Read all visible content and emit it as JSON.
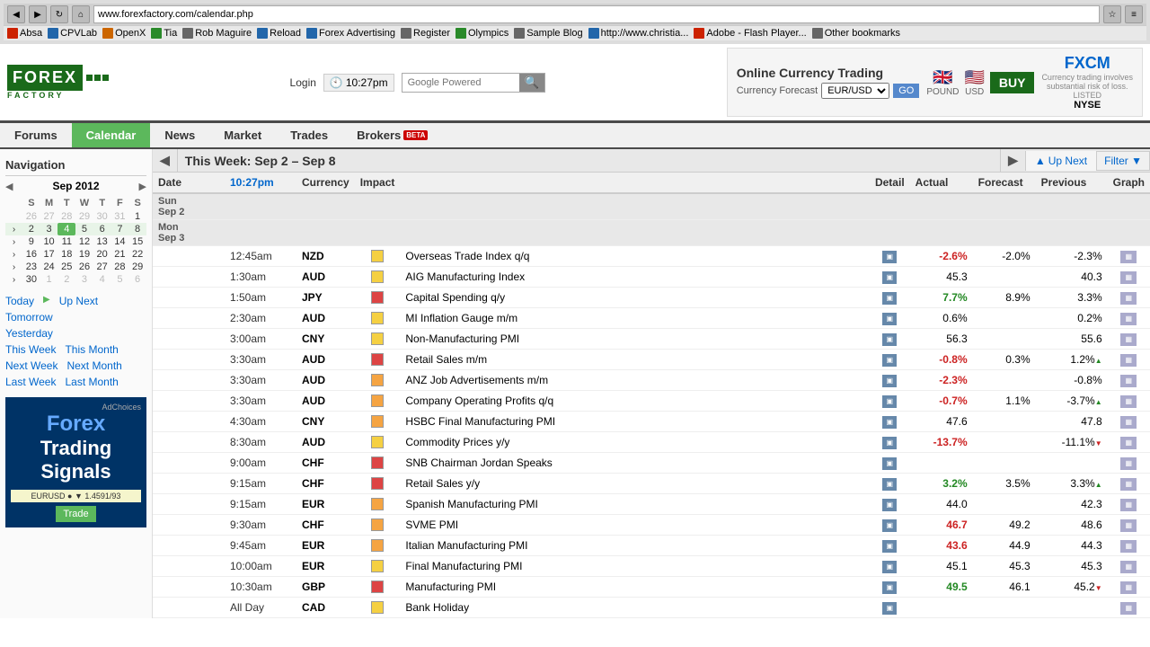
{
  "browser": {
    "url": "www.forexfactory.com/calendar.php",
    "bookmarks": [
      {
        "label": "Absa",
        "icon": "red"
      },
      {
        "label": "CPVLab",
        "icon": "blue"
      },
      {
        "label": "OpenX",
        "icon": "orange"
      },
      {
        "label": "Tia",
        "icon": "green"
      },
      {
        "label": "Rob Maguire",
        "icon": "gray"
      },
      {
        "label": "Reload",
        "icon": "blue"
      },
      {
        "label": "Forex Advertising",
        "icon": "blue"
      },
      {
        "label": "Register",
        "icon": "gray"
      },
      {
        "label": "Olympics",
        "icon": "green"
      },
      {
        "label": "Sample Blog",
        "icon": "gray"
      },
      {
        "label": "http://www.christia...",
        "icon": "blue"
      },
      {
        "label": "Adobe - Flash Player...",
        "icon": "red"
      },
      {
        "label": "Other bookmarks",
        "icon": "gray"
      }
    ]
  },
  "header": {
    "logo_top": "FOREX",
    "logo_bottom": "FACTORY",
    "login_label": "Login",
    "time_label": "10:27pm",
    "search_placeholder": "Google Powered",
    "ad_title": "Online Currency Trading",
    "ad_currency_label": "Currency Forecast",
    "ad_currency_value": "EUR/USD",
    "ad_go_label": "GO",
    "ad_logo": "FXCM",
    "ad_listed": "NYSE"
  },
  "nav": {
    "items": [
      {
        "label": "Forums",
        "active": false
      },
      {
        "label": "Calendar",
        "active": true
      },
      {
        "label": "News",
        "active": false
      },
      {
        "label": "Market",
        "active": false
      },
      {
        "label": "Trades",
        "active": false
      },
      {
        "label": "Brokers",
        "active": false,
        "beta": true
      }
    ]
  },
  "sidebar": {
    "title": "Navigation",
    "calendar": {
      "month_year": "Sep 2012",
      "headers": [
        "S",
        "M",
        "T",
        "W",
        "T",
        "F",
        "S"
      ],
      "weeks": [
        {
          "num": "",
          "days": [
            {
              "d": "26",
              "other": true
            },
            {
              "d": "27",
              "other": true
            },
            {
              "d": "28",
              "other": true
            },
            {
              "d": "29",
              "other": true
            },
            {
              "d": "30",
              "other": true
            },
            {
              "d": "31",
              "other": true
            },
            {
              "d": "1",
              "weekend": false
            }
          ]
        },
        {
          "num": "",
          "days": [
            {
              "d": "2",
              "cur": true,
              "weekend": true
            },
            {
              "d": "3",
              "cur": true
            },
            {
              "d": "4",
              "cur": true
            },
            {
              "d": "5",
              "cur": true
            },
            {
              "d": "6",
              "cur": true
            },
            {
              "d": "7",
              "cur": true
            },
            {
              "d": "8",
              "cur": true,
              "weekend": true
            }
          ]
        },
        {
          "num": "",
          "days": [
            {
              "d": "9",
              "weekend": true
            },
            {
              "d": "10"
            },
            {
              "d": "11"
            },
            {
              "d": "12"
            },
            {
              "d": "13"
            },
            {
              "d": "14"
            },
            {
              "d": "15",
              "weekend": true
            }
          ]
        },
        {
          "num": "",
          "days": [
            {
              "d": "16",
              "weekend": true
            },
            {
              "d": "17"
            },
            {
              "d": "18"
            },
            {
              "d": "19"
            },
            {
              "d": "20"
            },
            {
              "d": "21"
            },
            {
              "d": "22",
              "weekend": true
            }
          ]
        },
        {
          "num": "",
          "days": [
            {
              "d": "23",
              "weekend": true
            },
            {
              "d": "24"
            },
            {
              "d": "25"
            },
            {
              "d": "26"
            },
            {
              "d": "27"
            },
            {
              "d": "28"
            },
            {
              "d": "29",
              "weekend": true
            }
          ]
        },
        {
          "num": "",
          "days": [
            {
              "d": "30",
              "weekend": true
            },
            {
              "d": "1",
              "other": true
            },
            {
              "d": "2",
              "other": true
            },
            {
              "d": "3",
              "other": true
            },
            {
              "d": "4",
              "other": true
            },
            {
              "d": "5",
              "other": true
            },
            {
              "d": "6",
              "other": true,
              "weekend": true
            }
          ]
        }
      ]
    },
    "quick_links": [
      {
        "label": "Today",
        "href": "#"
      },
      {
        "label": "Up Next",
        "href": "#"
      },
      {
        "label": "Tomorrow",
        "href": "#"
      },
      {
        "label": "Yesterday",
        "href": "#"
      },
      {
        "label": "This Week",
        "href": "#"
      },
      {
        "label": "This Month",
        "href": "#"
      },
      {
        "label": "Next Week",
        "href": "#"
      },
      {
        "label": "Next Month",
        "href": "#"
      },
      {
        "label": "Last Week",
        "href": "#"
      },
      {
        "label": "Last Month",
        "href": "#"
      }
    ],
    "ad": {
      "label": "AdChoices",
      "brand": "Forex",
      "sub": "Trading\nSignals"
    }
  },
  "calendar": {
    "week_title": "This Week: Sep 2 – Sep 8",
    "prev_btn": "◀",
    "next_btn": "▶",
    "up_next_label": "Up Next",
    "filter_label": "Filter ▼",
    "columns": {
      "date": "Date",
      "time": "10:27pm",
      "currency": "Currency",
      "impact": "Impact",
      "detail": "Detail",
      "actual": "Actual",
      "forecast": "Forecast",
      "previous": "Previous",
      "graph": "Graph"
    },
    "sections": [
      {
        "day_label": "Sun\nSep 2",
        "events": []
      },
      {
        "day_label": "Mon\nSep 3",
        "events": [
          {
            "time": "12:45am",
            "currency": "NZD",
            "impact": "yellow",
            "event": "Overseas Trade Index q/q",
            "actual": "-2.6%",
            "actual_class": "red",
            "forecast": "-2.0%",
            "previous": "-2.3%",
            "prev_class": ""
          },
          {
            "time": "1:30am",
            "currency": "AUD",
            "impact": "yellow",
            "event": "AIG Manufacturing Index",
            "actual": "45.3",
            "actual_class": "",
            "forecast": "",
            "previous": "40.3",
            "prev_class": ""
          },
          {
            "time": "1:50am",
            "currency": "JPY",
            "impact": "red",
            "event": "Capital Spending q/y",
            "actual": "7.7%",
            "actual_class": "green",
            "forecast": "8.9%",
            "previous": "3.3%",
            "prev_class": ""
          },
          {
            "time": "2:30am",
            "currency": "AUD",
            "impact": "yellow",
            "event": "MI Inflation Gauge m/m",
            "actual": "0.6%",
            "actual_class": "",
            "forecast": "",
            "previous": "0.2%",
            "prev_class": ""
          },
          {
            "time": "3:00am",
            "currency": "CNY",
            "impact": "yellow",
            "event": "Non-Manufacturing PMI",
            "actual": "56.3",
            "actual_class": "",
            "forecast": "",
            "previous": "55.6",
            "prev_class": ""
          },
          {
            "time": "3:30am",
            "currency": "AUD",
            "impact": "red",
            "event": "Retail Sales m/m",
            "actual": "-0.8%",
            "actual_class": "red",
            "forecast": "0.3%",
            "previous": "1.2%",
            "prev_class": "up"
          },
          {
            "time": "3:30am",
            "currency": "AUD",
            "impact": "orange",
            "event": "ANZ Job Advertisements m/m",
            "actual": "-2.3%",
            "actual_class": "red",
            "forecast": "",
            "previous": "-0.8%",
            "prev_class": ""
          },
          {
            "time": "3:30am",
            "currency": "AUD",
            "impact": "orange",
            "event": "Company Operating Profits q/q",
            "actual": "-0.7%",
            "actual_class": "red",
            "forecast": "1.1%",
            "previous": "-3.7%",
            "prev_class": "up"
          },
          {
            "time": "4:30am",
            "currency": "CNY",
            "impact": "orange",
            "event": "HSBC Final Manufacturing PMI",
            "actual": "47.6",
            "actual_class": "",
            "forecast": "",
            "previous": "47.8",
            "prev_class": ""
          },
          {
            "time": "8:30am",
            "currency": "AUD",
            "impact": "yellow",
            "event": "Commodity Prices y/y",
            "actual": "-13.7%",
            "actual_class": "red",
            "forecast": "",
            "previous": "-11.1%",
            "prev_class": "down"
          },
          {
            "time": "9:00am",
            "currency": "CHF",
            "impact": "red",
            "event": "SNB Chairman Jordan Speaks",
            "actual": "",
            "actual_class": "",
            "forecast": "",
            "previous": "",
            "prev_class": ""
          },
          {
            "time": "9:15am",
            "currency": "CHF",
            "impact": "red",
            "event": "Retail Sales y/y",
            "actual": "3.2%",
            "actual_class": "green",
            "forecast": "3.5%",
            "previous": "3.3%",
            "prev_class": "up"
          },
          {
            "time": "9:15am",
            "currency": "EUR",
            "impact": "orange",
            "event": "Spanish Manufacturing PMI",
            "actual": "44.0",
            "actual_class": "",
            "forecast": "",
            "previous": "42.3",
            "prev_class": ""
          },
          {
            "time": "9:30am",
            "currency": "CHF",
            "impact": "orange",
            "event": "SVME PMI",
            "actual": "46.7",
            "actual_class": "red",
            "forecast": "49.2",
            "previous": "48.6",
            "prev_class": ""
          },
          {
            "time": "9:45am",
            "currency": "EUR",
            "impact": "orange",
            "event": "Italian Manufacturing PMI",
            "actual": "43.6",
            "actual_class": "red",
            "forecast": "44.9",
            "previous": "44.3",
            "prev_class": ""
          },
          {
            "time": "10:00am",
            "currency": "EUR",
            "impact": "yellow",
            "event": "Final Manufacturing PMI",
            "actual": "45.1",
            "actual_class": "",
            "forecast": "45.3",
            "previous": "45.3",
            "prev_class": ""
          },
          {
            "time": "10:30am",
            "currency": "GBP",
            "impact": "red",
            "event": "Manufacturing PMI",
            "actual": "49.5",
            "actual_class": "green",
            "forecast": "46.1",
            "previous": "45.2",
            "prev_class": "down"
          },
          {
            "time": "All Day",
            "currency": "CAD",
            "impact": "gray",
            "event": "Bank Holiday",
            "actual": "",
            "actual_class": "",
            "forecast": "",
            "previous": "",
            "prev_class": ""
          }
        ]
      }
    ]
  }
}
